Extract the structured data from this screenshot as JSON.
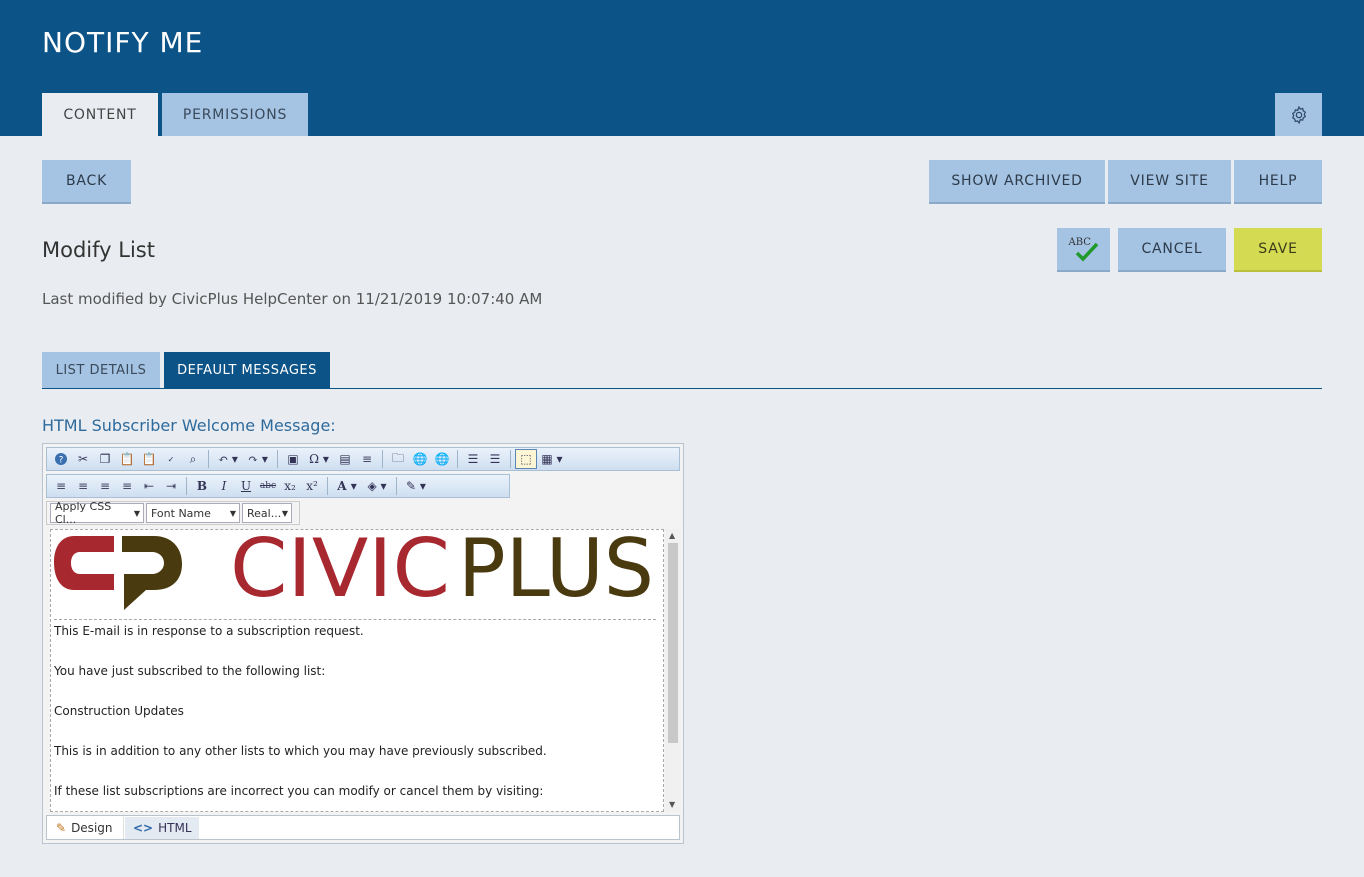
{
  "app": {
    "title": "NOTIFY ME"
  },
  "top_tabs": [
    {
      "label": "CONTENT",
      "active": true
    },
    {
      "label": "PERMISSIONS",
      "active": false
    }
  ],
  "settings_icon": "gear-icon",
  "actions": {
    "back": "BACK",
    "show_archived": "SHOW ARCHIVED",
    "view_site": "VIEW SITE",
    "help": "HELP",
    "spellcheck_label": "ABC",
    "cancel": "CANCEL",
    "save": "SAVE"
  },
  "page": {
    "title": "Modify List",
    "last_modified": "Last modified by CivicPlus HelpCenter on 11/21/2019 10:07:40 AM"
  },
  "sub_tabs": [
    {
      "label": "LIST DETAILS",
      "active": false
    },
    {
      "label": "DEFAULT MESSAGES",
      "active": true
    }
  ],
  "field": {
    "label": "HTML Subscriber Welcome Message:"
  },
  "editor": {
    "dropdowns": {
      "css_class": "Apply CSS Cl...",
      "font_name": "Font Name",
      "font_size": "Real..."
    },
    "logo_text": {
      "civic": "CIVIC",
      "plus": "PLUS"
    },
    "lines": [
      "This E-mail is in response to a subscription request.",
      "You have just subscribed to the following list:",
      "Construction Updates",
      "This is in addition to any other lists to which you may have previously subscribed.",
      "If these list subscriptions are incorrect you can modify or cancel them by visiting:"
    ],
    "modes": {
      "design": "Design",
      "html": "HTML"
    }
  },
  "colors": {
    "header": "#0c5387",
    "tab_inactive": "#a5c3e3",
    "save": "#d4db53",
    "logo_red": "#a8282f",
    "logo_brown": "#4a3a10"
  }
}
